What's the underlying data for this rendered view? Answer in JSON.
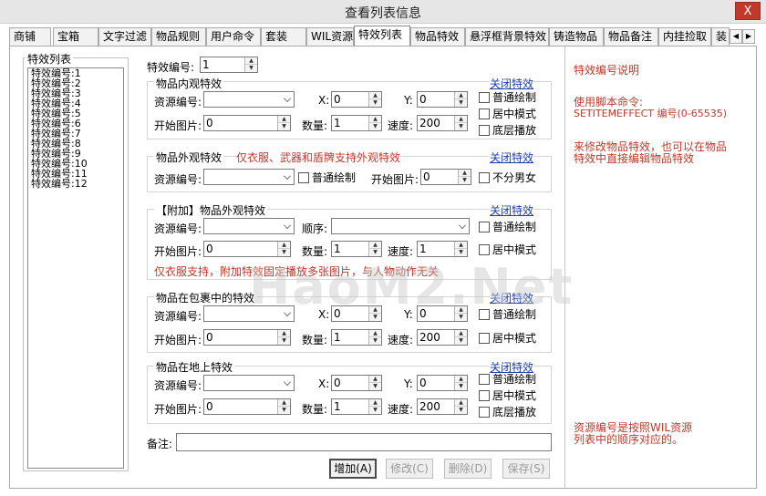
{
  "window": {
    "title": "查看列表信息",
    "close_label": "X"
  },
  "tabs": [
    "商铺",
    "宝箱",
    "文字过滤",
    "物品规则",
    "用户命令",
    "套装",
    "WIL资源",
    "特效列表",
    "物品特效",
    "悬浮框背景特效",
    "铸造物品",
    "物品备注",
    "内挂捡取",
    "装"
  ],
  "active_tab": "特效列表",
  "effect_list": {
    "group_label": "特效列表",
    "items": [
      "特效编号:1",
      "特效编号:2",
      "特效编号:3",
      "特效编号:4",
      "特效编号:5",
      "特效编号:6",
      "特效编号:7",
      "特效编号:8",
      "特效编号:9",
      "特效编号:10",
      "特效编号:11",
      "特效编号:12"
    ]
  },
  "effect_id": {
    "label": "特效编号:",
    "value": "1"
  },
  "inner": {
    "title": "物品内观特效",
    "close_link": "关闭特效",
    "res_label": "资源编号:",
    "x_label": "X:",
    "x_value": "0",
    "y_label": "Y:",
    "y_value": "0",
    "start_label": "开始图片:",
    "start_value": "0",
    "count_label": "数量:",
    "count_value": "1",
    "speed_label": "速度:",
    "speed_value": "200",
    "chk_normal": "普通绘制",
    "chk_center": "居中模式",
    "chk_bottom": "底层播放"
  },
  "outer": {
    "title": "物品外观特效",
    "note": "仅衣服、武器和盾牌支持外观特效",
    "close_link": "关闭特效",
    "res_label": "资源编号:",
    "chk_normal": "普通绘制",
    "start_label": "开始图片:",
    "start_value": "0",
    "chk_gender": "不分男女"
  },
  "extra": {
    "title": "【附加】物品外观特效",
    "close_link": "关闭特效",
    "res_label": "资源编号:",
    "order_label": "顺序:",
    "chk_normal": "普通绘制",
    "start_label": "开始图片:",
    "start_value": "0",
    "count_label": "数量:",
    "count_value": "1",
    "speed_label": "速度:",
    "speed_value": "1",
    "chk_center": "居中模式",
    "note": "仅衣服支持，附加特效固定播放多张图片，与人物动作无关"
  },
  "bag": {
    "title": "物品在包裹中的特效",
    "close_link": "关闭特效",
    "res_label": "资源编号:",
    "x_label": "X:",
    "x_value": "0",
    "y_label": "Y:",
    "y_value": "0",
    "start_label": "开始图片:",
    "start_value": "0",
    "count_label": "数量:",
    "count_value": "1",
    "speed_label": "速度:",
    "speed_value": "200",
    "chk_normal": "普通绘制",
    "chk_center": "居中模式"
  },
  "ground": {
    "title": "物品在地上特效",
    "close_link": "关闭特效",
    "res_label": "资源编号:",
    "x_label": "X:",
    "x_value": "0",
    "y_label": "Y:",
    "y_value": "0",
    "start_label": "开始图片:",
    "start_value": "0",
    "count_label": "数量:",
    "count_value": "1",
    "speed_label": "速度:",
    "speed_value": "200",
    "chk_normal": "普通绘制",
    "chk_center": "居中模式",
    "chk_bottom": "底层播放"
  },
  "memo": {
    "label": "备注:",
    "value": ""
  },
  "buttons": {
    "add": "增加(A)",
    "modify": "修改(C)",
    "delete": "删除(D)",
    "save": "保存(S)"
  },
  "help": {
    "title": "特效编号说明",
    "line1": "使用脚本命令:",
    "line2": "SETITEMEFFECT 编号(0-65535)",
    "line3": "来修改物品特效，也可以在物品",
    "line4": "特效中直接编辑物品特效",
    "line5": "资源编号是按照WIL资源",
    "line6": "列表中的顺序对应的。"
  },
  "watermark": "HaoM2.Net",
  "colors": {
    "red_text": "#c0392b",
    "link": "#1f3fa6"
  }
}
